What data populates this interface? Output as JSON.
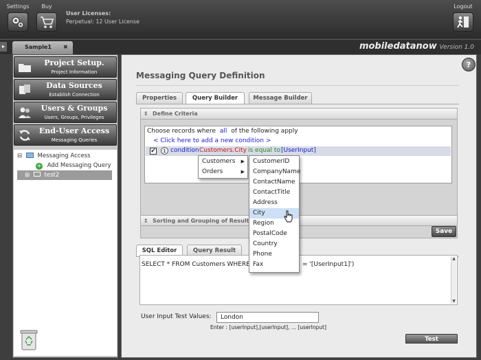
{
  "topbar": {
    "settings_label": "Settings",
    "buy_label": "Buy",
    "licenses_title": "User Licenses:",
    "licenses_value": "Perpetual:  12 User License",
    "logout_label": "Logout"
  },
  "tabs": {
    "document_tab": "Sample1",
    "close_glyph": "✖"
  },
  "brand": {
    "name": "mobiledatanow",
    "version": "Version 1.0"
  },
  "nav": [
    {
      "title": "Project Setup.",
      "subtitle": "Project Information"
    },
    {
      "title": "Data Sources",
      "subtitle": "Establish Connection"
    },
    {
      "title": "Users & Groups",
      "subtitle": "Users, Groups, Privileges"
    },
    {
      "title": "End-User Access",
      "subtitle": "Messaging Queries"
    }
  ],
  "tree": {
    "root": "Messaging Access",
    "add_item": "Add Messaging Query",
    "child": "test2",
    "expand_glyph": "⊟",
    "collapse_glyph": "⊞"
  },
  "main": {
    "title": "Messaging Query Definition",
    "help_glyph": "?",
    "tabs": [
      "Properties",
      "Query Builder",
      "Message Builder"
    ],
    "criteria_header": "Define Criteria",
    "choose_prefix": "Choose records where",
    "choose_all": "all",
    "choose_suffix": "of the following apply",
    "add_condition": "< Click here to add a new condition >",
    "condition_num": "1",
    "condition_word": "condition",
    "condition_field": "Customers.City",
    "condition_op": "is equal to",
    "condition_value": "[UserInput]",
    "sorting_header": "Sorting and Grouping of Results",
    "save_label": "Save",
    "bottom_tabs": [
      "SQL Editor",
      "Query Result"
    ],
    "sql_left": "SELECT * FROM Customers WHERE (",
    "sql_right": "= '[UserInput1]')",
    "test_values_label": "User Input Test Values:",
    "test_values_value": "London",
    "hint": "Enter : [userInput],[userInput], ... [userInput]",
    "test_label": "Test"
  },
  "table_menu": [
    "Customers",
    "Orders"
  ],
  "field_menu": [
    "CustomerID",
    "CompanyName",
    "ContactName",
    "ContactTitle",
    "Address",
    "City",
    "Region",
    "PostalCode",
    "Country",
    "Phone",
    "Fax"
  ],
  "colors": {
    "accent_blue": "#1a1adb",
    "field_red": "#cc1111",
    "op_green": "#2a8a2a",
    "highlight": "#cde0f5"
  }
}
